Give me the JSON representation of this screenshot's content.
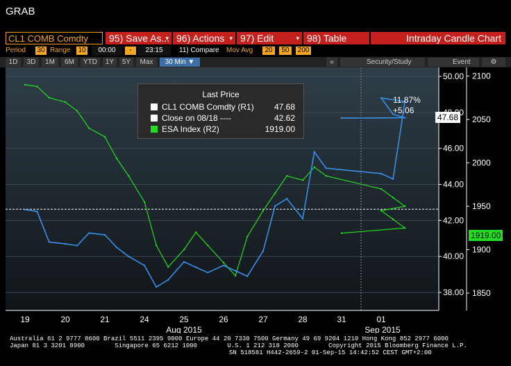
{
  "app_title": "GRAB",
  "toolbar": {
    "ticker": "CL1 COMB Comdty",
    "save_label": "95) Save As...",
    "actions_label": "96) Actions",
    "edit_label": "97) Edit",
    "table_label": "98) Table",
    "chart_type_label": "Intraday Candle Chart"
  },
  "settings": {
    "period_label": "Period",
    "period_value": "30",
    "range_label": "Range",
    "range_value": "10",
    "time_start": "00:00",
    "time_sep": "-",
    "time_end": "23:15",
    "compare_label": "11) Compare",
    "mov_avg_label": "Mov Avg",
    "mov_avg_values": [
      "20",
      "50",
      "200"
    ]
  },
  "periods": {
    "items": [
      "1D",
      "3D",
      "1M",
      "6M",
      "YTD",
      "1Y",
      "5Y",
      "Max",
      "30 Min ▼"
    ],
    "selected": "30 Min ▼"
  },
  "tools": {
    "collapse": "«",
    "security_study": "Security/Study",
    "event": "Event",
    "gear": "⚙"
  },
  "legend": {
    "title": "Last Price",
    "rows": [
      {
        "name": "CL1 COMB Comdty  (R1)",
        "value": "47.68",
        "color": "#ffffff"
      },
      {
        "name": "Close on 08/18 ----",
        "value": "42.62",
        "color": "#ffffff"
      },
      {
        "name": "ESA Index  (R2)",
        "value": "1919.00",
        "color": "#22dd22"
      }
    ]
  },
  "annotations": {
    "change_pct": "11.87%",
    "change_abs": "+5.06",
    "last_tag_r1": "47.68",
    "last_tag_r2": "1919.00"
  },
  "chart_data": {
    "type": "line",
    "x_ticks": [
      "19",
      "20",
      "21",
      "24",
      "25",
      "26",
      "27",
      "28",
      "31",
      "01"
    ],
    "x_group_labels": [
      "Aug 2015",
      "Sep 2015"
    ],
    "y1_ticks": [
      "38.00",
      "40.00",
      "42.00",
      "44.00",
      "46.00",
      "48.00",
      "50.00"
    ],
    "y1_range": [
      37,
      50.5
    ],
    "y2_ticks": [
      "1850",
      "1900",
      "1950",
      "2000",
      "2050",
      "2100"
    ],
    "y2_range": [
      1830,
      2110
    ],
    "reference_line": 42.62,
    "series": [
      {
        "name": "CL1 COMB Comdty (R1)",
        "color": "#3a8fe8",
        "x": [
          19.0,
          19.3,
          19.6,
          20.0,
          20.3,
          20.6,
          21.0,
          21.3,
          21.6,
          24.0,
          24.3,
          24.6,
          25.0,
          25.3,
          25.6,
          26.0,
          26.3,
          26.6,
          27.0,
          27.3,
          27.6,
          28.0,
          28.3,
          28.6,
          29.0,
          29.3,
          29.6,
          30.0,
          30.3,
          30.6,
          31.0
        ],
        "values": [
          42.6,
          42.5,
          40.8,
          40.7,
          40.6,
          41.3,
          41.2,
          40.5,
          40.0,
          39.5,
          38.3,
          38.7,
          39.7,
          39.4,
          39.1,
          39.5,
          39.2,
          38.9,
          40.3,
          42.8,
          43.2,
          42.1,
          45.8,
          44.9,
          44.6,
          44.3,
          48.6,
          48.8,
          47.9,
          47.7,
          47.68
        ]
      },
      {
        "name": "ESA Index (R2)",
        "color": "#22dd22",
        "x": [
          19.0,
          19.3,
          19.6,
          20.0,
          20.3,
          20.6,
          21.0,
          21.3,
          21.6,
          24.0,
          24.3,
          24.6,
          25.0,
          25.3,
          25.6,
          26.0,
          26.3,
          26.6,
          27.0,
          27.3,
          27.6,
          28.0,
          28.3,
          28.6,
          29.0,
          29.3,
          29.6,
          30.0,
          30.3,
          30.6,
          31.0
        ],
        "values": [
          2090,
          2088,
          2075,
          2070,
          2060,
          2040,
          2030,
          2005,
          1985,
          1955,
          1905,
          1880,
          1900,
          1920,
          1905,
          1885,
          1870,
          1915,
          1945,
          1965,
          1985,
          1980,
          1995,
          1985,
          1970,
          1960,
          1950,
          1945,
          1935,
          1925,
          1919
        ]
      }
    ]
  }
}
